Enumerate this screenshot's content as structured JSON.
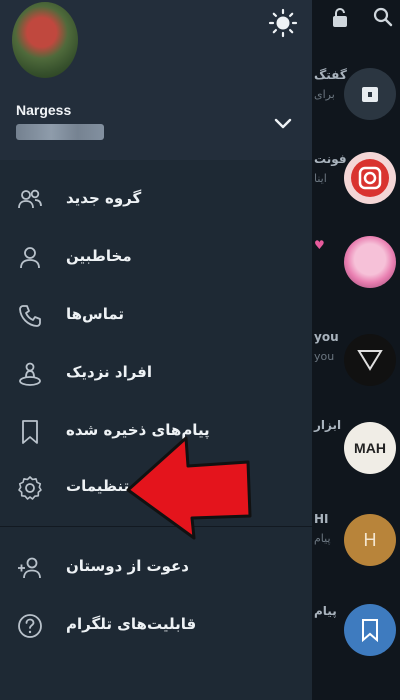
{
  "drawer": {
    "user_name": "Nargess",
    "menu": [
      {
        "label": "گروه جدید",
        "icon": "group-icon"
      },
      {
        "label": "مخاطبین",
        "icon": "contacts-icon"
      },
      {
        "label": "تماس‌ها",
        "icon": "phone-icon"
      },
      {
        "label": "افراد نزدیک",
        "icon": "nearby-people-icon"
      },
      {
        "label": "پیام‌های ذخیره شده",
        "icon": "bookmark-icon"
      },
      {
        "label": "تنظیمات",
        "icon": "settings-icon"
      }
    ],
    "secondary_menu": [
      {
        "label": "دعوت از دوستان",
        "icon": "invite-friends-icon"
      },
      {
        "label": "قابلیت‌های تلگرام",
        "icon": "help-icon"
      }
    ]
  },
  "background_chats": [
    {
      "line1": "گفتگ",
      "line2": "برای"
    },
    {
      "line1": "فونت",
      "line2": "اینا"
    },
    {
      "line1": "",
      "line2": ""
    },
    {
      "line1": "you",
      "line2": "you"
    },
    {
      "line1": "ابزار",
      "line2": ""
    },
    {
      "line1": "HI",
      "line2": "پیام"
    },
    {
      "line1": "پیام",
      "line2": ""
    }
  ],
  "background_avatars": {
    "mah_label": "MAH",
    "h_label": "H"
  },
  "colors": {
    "drawer_bg": "#1e2934",
    "header_bg": "#232e3b",
    "arrow": "#e4141c"
  }
}
